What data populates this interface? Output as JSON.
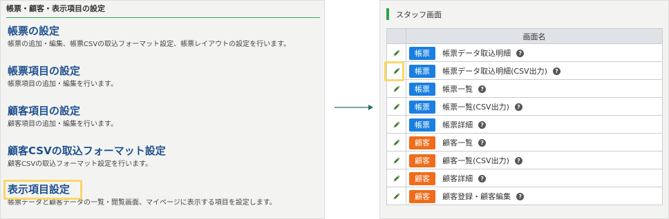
{
  "left": {
    "header": "帳票・顧客・表示項目の設定",
    "sections": [
      {
        "title": "帳票の設定",
        "desc": "帳票の追加・編集、帳票CSVの取込フォーマット設定、帳票レイアウトの設定を行います。"
      },
      {
        "title": "帳票項目の設定",
        "desc": "帳票項目の追加・編集を行います。"
      },
      {
        "title": "顧客項目の設定",
        "desc": "顧客項目の追加・編集を行います。"
      },
      {
        "title": "顧客CSVの取込フォーマット設定",
        "desc": "顧客CSVの取込フォーマット設定を行います。"
      },
      {
        "title": "表示項目設定",
        "desc": "帳票データと顧客データの一覧・閲覧画面、マイページに表示する項目を設定します。"
      }
    ],
    "highlight_color": "#f9d768"
  },
  "right": {
    "header": "スタッフ画面",
    "table_header": "画面名",
    "rows": [
      {
        "badge": "帳票",
        "label": "帳票データ取込明細"
      },
      {
        "badge": "帳票",
        "label": "帳票データ取込明細(CSV出力)"
      },
      {
        "badge": "帳票",
        "label": "帳票一覧"
      },
      {
        "badge": "帳票",
        "label": "帳票一覧(CSV出力)"
      },
      {
        "badge": "帳票",
        "label": "帳票詳細"
      },
      {
        "badge": "顧客",
        "label": "顧客一覧"
      },
      {
        "badge": "顧客",
        "label": "顧客一覧(CSV出力)"
      },
      {
        "badge": "顧客",
        "label": "顧客詳細"
      },
      {
        "badge": "顧客",
        "label": "顧客登録・顧客編集"
      }
    ],
    "help_glyph": "?",
    "colors": {
      "form_badge": "#1a7fe0",
      "customer_badge": "#ef6c1a",
      "accent_green": "#2ea04a"
    }
  }
}
